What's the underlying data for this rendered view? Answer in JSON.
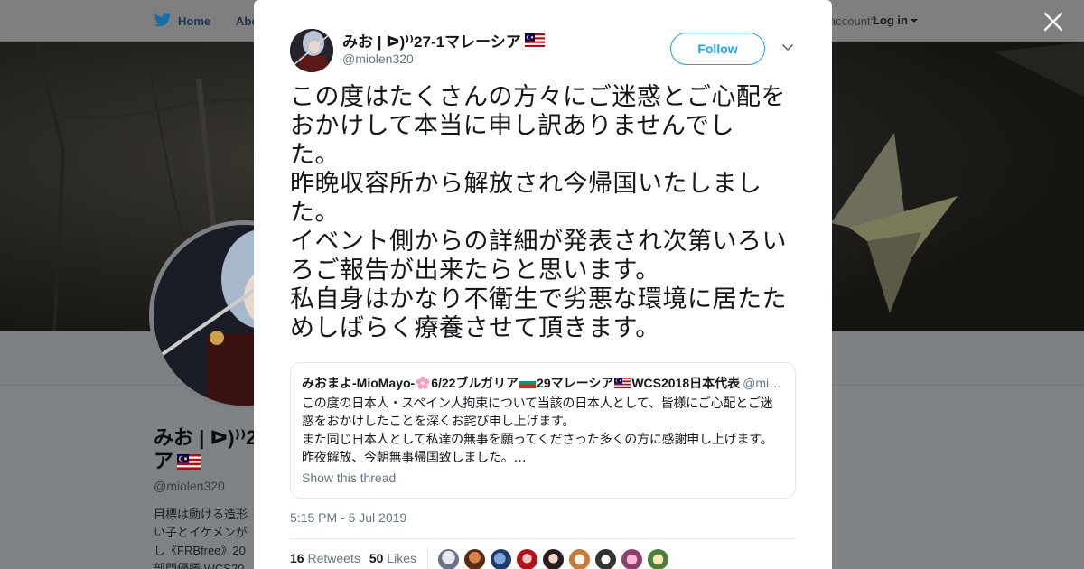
{
  "nav": {
    "home": "Home",
    "about": "Abo",
    "account": "account?",
    "login": "Log in"
  },
  "profile": {
    "name_line1": "みお | ᐅ)⁾⁾2",
    "name_line2": "ア",
    "handle": "@miolen320",
    "bio": "目標は動ける造形 い子とイケメンが し《FRBfree》20 部門優勝 WCS20"
  },
  "tweet": {
    "author_name": "みお | ᐅ)⁾⁾27-1マレーシア",
    "author_handle": "@miolen320",
    "follow_label": "Follow",
    "text_lines": [
      "この度はたくさんの方々にご迷惑とご心配を",
      "おかけして本当に申し訳ありませんでし",
      "た。",
      "昨晩収容所から解放され今帰国いたしまし",
      "た。",
      "イベント側からの詳細が発表され次第いろい",
      "ろご報告が出来たらと思います。",
      "私自身はかなり不衛生で劣悪な環境に居たた",
      "めしばらく療養させて頂きます。"
    ],
    "quoted": {
      "name_part1": "みおまよ-MioMayo-",
      "name_part2": "6/22ブルガリア",
      "name_part3": "29マレーシア",
      "name_part4": "WCS2018日本代表",
      "handle": "@mi…",
      "lines": [
        "この度の日本人・スペイン人拘束について当該の日本人として、皆様にご心配とご迷",
        "惑をおかけしたことを深くお詫び申し上げます。",
        "また同じ日本人として私達の無事を願ってくださった多くの方に感謝申し上げます。",
        "昨夜解放、今朝無事帰国致しました。…"
      ],
      "show_thread": "Show this thread"
    },
    "timestamp": "5:15 PM - 5 Jul 2019",
    "retweets_count": "16",
    "retweets_label": "Retweets",
    "likes_count": "50",
    "likes_label": "Likes"
  },
  "colors": {
    "accent": "#1da1f2",
    "text_primary": "#14171a",
    "text_secondary": "#657786",
    "overlay": "#7f8386"
  },
  "icons": [
    "twitter-bird-icon",
    "close-icon",
    "chevron-down-icon",
    "malaysia-flag-icon",
    "bulgaria-flag-icon",
    "sakura-icon"
  ]
}
